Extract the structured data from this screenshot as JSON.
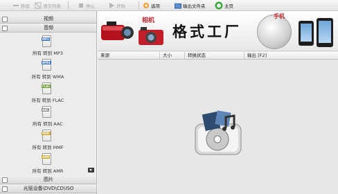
{
  "toolbar": {
    "remove_label": "移除",
    "clear_label": "清空列表",
    "stop_label": "停止",
    "start_label": "开始",
    "options_label": "选项",
    "output_folder_label": "输出文件夹",
    "home_label": "主页"
  },
  "sidebar": {
    "video_label": "视频",
    "audio_label": "音频",
    "items": [
      {
        "label": "所有 转到 MP3",
        "tag": "MP3"
      },
      {
        "label": "所有 转到 WMA",
        "tag": "WMA"
      },
      {
        "label": "所有 转到 FLAC",
        "tag": "FLAC"
      },
      {
        "label": "所有 转到 AAC",
        "tag": "AAC"
      },
      {
        "label": "所有 转到 MMF",
        "tag": "MMF"
      },
      {
        "label": "所有 转到 AMR",
        "tag": "AMR"
      }
    ],
    "picture_label": "图片",
    "optical_label": "光驱设备\\DVD\\CD\\ISO"
  },
  "banner": {
    "title": "格式工厂",
    "camera_text": "相机",
    "phone_text": "手机"
  },
  "table": {
    "col_source": "来源",
    "col_size": "大小",
    "col_status": "转换状态",
    "col_output": "输出 [F2]"
  },
  "colors": {
    "accent_red": "#c0272d",
    "toolbar_orange": "#f0a23a"
  }
}
